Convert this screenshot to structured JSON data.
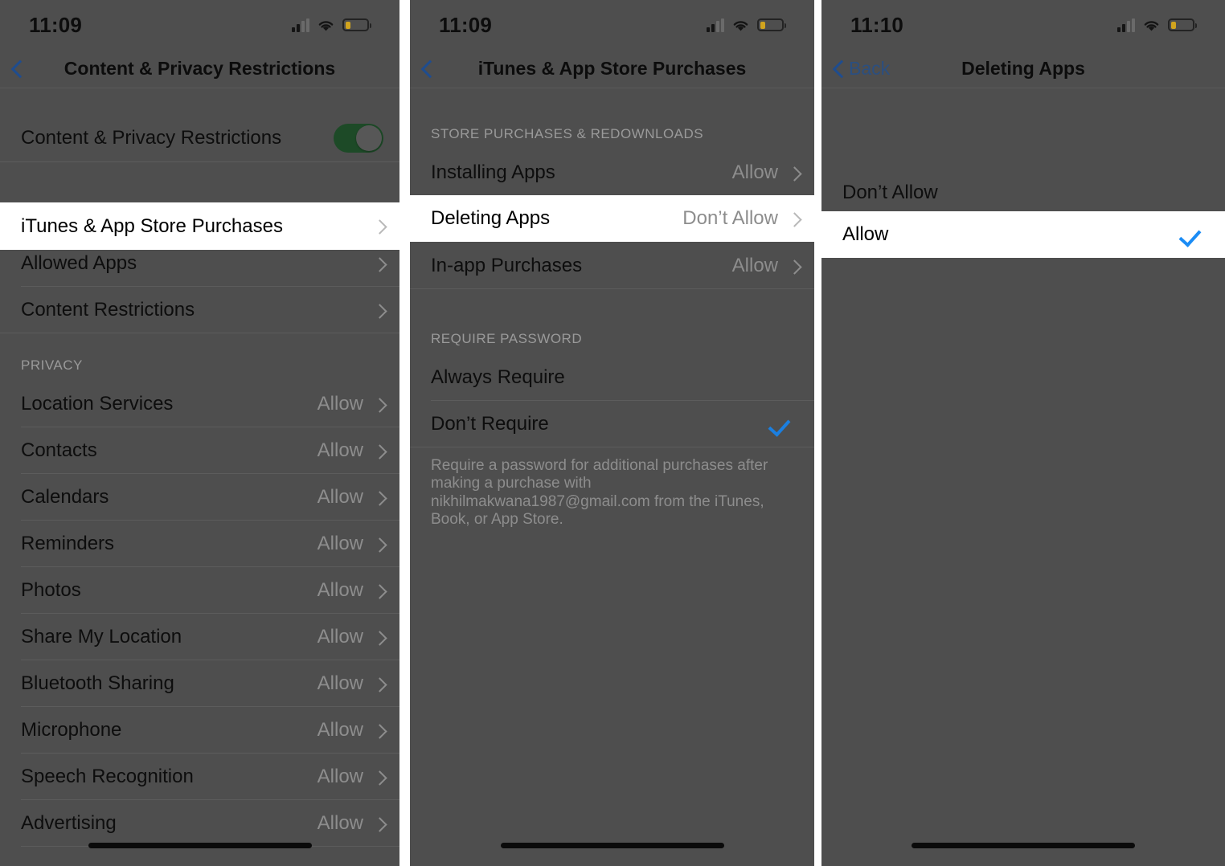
{
  "panels": [
    {
      "id": "content-privacy-restrictions",
      "status": {
        "time": "11:09",
        "signal_icon": "cellular-signal-icon",
        "wifi_icon": "wifi-icon",
        "battery_icon": "battery-low-icon"
      },
      "nav": {
        "back_icon": "chevron-left-icon",
        "back_label": "",
        "title": "Content & Privacy Restrictions"
      },
      "toggle_row": {
        "label": "Content & Privacy Restrictions",
        "state": "on"
      },
      "highlighted_row": {
        "label": "iTunes & App Store Purchases",
        "value": "",
        "chevron_icon": "chevron-right-icon"
      },
      "group_rows": [
        {
          "label": "Allowed Apps",
          "value": "",
          "chevron_icon": "chevron-right-icon"
        },
        {
          "label": "Content Restrictions",
          "value": "",
          "chevron_icon": "chevron-right-icon"
        }
      ],
      "privacy_header": "PRIVACY",
      "privacy_rows": [
        {
          "label": "Location Services",
          "value": "Allow"
        },
        {
          "label": "Contacts",
          "value": "Allow"
        },
        {
          "label": "Calendars",
          "value": "Allow"
        },
        {
          "label": "Reminders",
          "value": "Allow"
        },
        {
          "label": "Photos",
          "value": "Allow"
        },
        {
          "label": "Share My Location",
          "value": "Allow"
        },
        {
          "label": "Bluetooth Sharing",
          "value": "Allow"
        },
        {
          "label": "Microphone",
          "value": "Allow"
        },
        {
          "label": "Speech Recognition",
          "value": "Allow"
        },
        {
          "label": "Advertising",
          "value": "Allow"
        }
      ]
    },
    {
      "id": "itunes-app-store-purchases",
      "status": {
        "time": "11:09",
        "signal_icon": "cellular-signal-icon",
        "wifi_icon": "wifi-icon",
        "battery_icon": "battery-low-icon"
      },
      "nav": {
        "back_icon": "chevron-left-icon",
        "back_label": "",
        "title": "iTunes & App Store Purchases"
      },
      "store_header": "STORE PURCHASES & REDOWNLOADS",
      "store_rows_top": [
        {
          "label": "Installing Apps",
          "value": "Allow"
        }
      ],
      "highlighted_row": {
        "label": "Deleting Apps",
        "value": "Don’t Allow",
        "chevron_icon": "chevron-right-icon"
      },
      "store_rows_bottom": [
        {
          "label": "In-app Purchases",
          "value": "Allow"
        }
      ],
      "password_header": "REQUIRE PASSWORD",
      "password_rows": [
        {
          "label": "Always Require",
          "checked": false
        },
        {
          "label": "Don’t Require",
          "checked": true
        }
      ],
      "footnote": "Require a password for additional purchases after making a purchase with nikhilmakwana1987@gmail.com from the iTunes, Book, or App Store."
    },
    {
      "id": "deleting-apps",
      "status": {
        "time": "11:10",
        "signal_icon": "cellular-signal-icon",
        "wifi_icon": "wifi-icon",
        "battery_icon": "battery-low-icon"
      },
      "nav": {
        "back_icon": "chevron-left-icon",
        "back_label": "Back",
        "title": "Deleting Apps"
      },
      "highlighted_row": {
        "label": "Allow",
        "checked": true,
        "check_icon": "checkmark-icon"
      },
      "option_rows": [
        {
          "label": "Don’t Allow",
          "checked": false
        }
      ]
    }
  ],
  "colors": {
    "dim_overlay": "#4e4e4e",
    "highlight_bg": "#ffffff",
    "accent_blue": "#1b8cf5",
    "nav_blue": "#2b4f80",
    "toggle_on_green": "#1d4a27",
    "battery_yellow": "#e8b416",
    "secondary_text": "#8d8d8d"
  }
}
